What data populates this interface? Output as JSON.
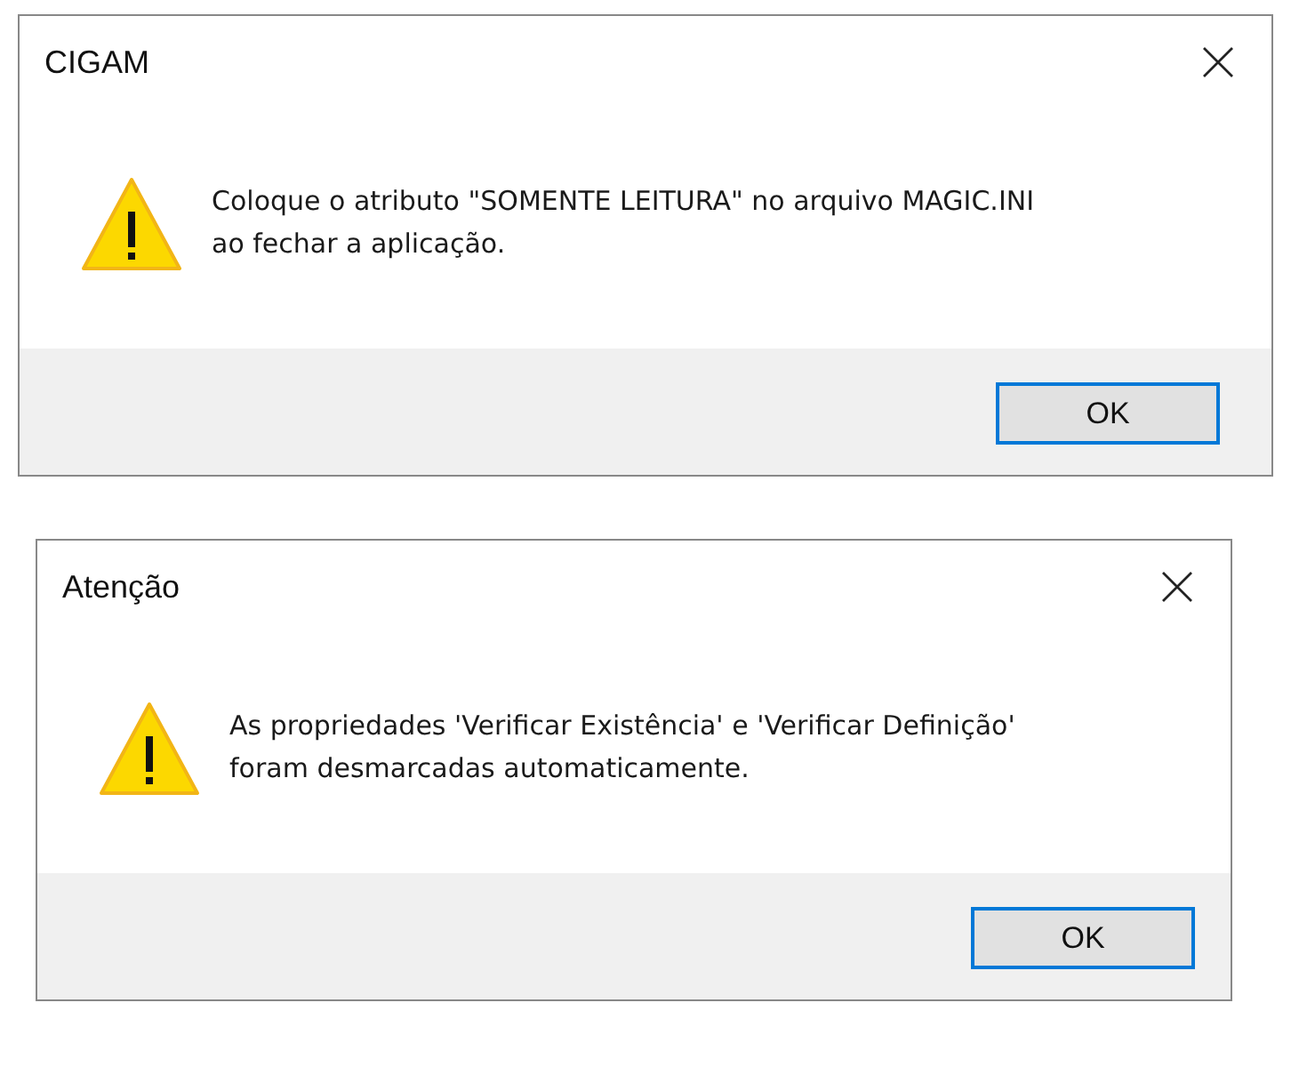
{
  "dialogs": [
    {
      "title": "CIGAM",
      "kind": "warning",
      "message_lines": [
        "Coloque o atributo \"SOMENTE LEITURA\" no arquivo MAGIC.INI",
        "ao fechar a aplicação."
      ],
      "buttons": [
        {
          "label": "OK",
          "selected": true
        }
      ]
    },
    {
      "title": "Atenção",
      "kind": "warning",
      "message_lines": [
        "As propriedades 'Verificar Existência' e 'Verificar Definição'",
        "foram desmarcadas automaticamente."
      ],
      "buttons": [
        {
          "label": "OK",
          "selected": true
        }
      ]
    }
  ]
}
